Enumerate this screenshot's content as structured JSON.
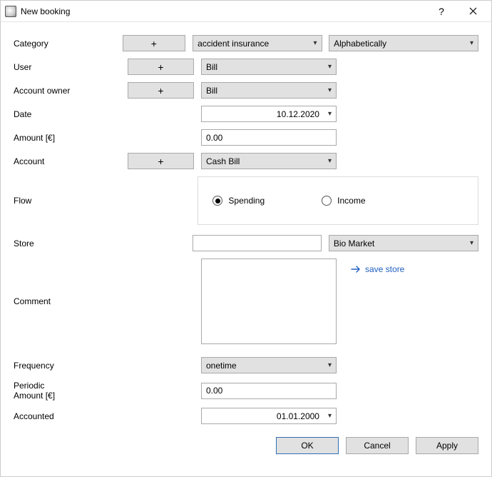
{
  "window": {
    "title": "New booking"
  },
  "labels": {
    "category": "Category",
    "user": "User",
    "account_owner": "Account owner",
    "date": "Date",
    "amount": "Amount [€]",
    "account": "Account",
    "flow": "Flow",
    "store": "Store",
    "comment": "Comment",
    "frequency": "Frequency",
    "periodic_amount": "Periodic\nAmount [€]",
    "accounted": "Accounted"
  },
  "values": {
    "category": "accident insurance",
    "category_sort": "Alphabetically",
    "user": "Bill",
    "account_owner": "Bill",
    "date": "10.12.2020",
    "amount": "0.00",
    "account": "Cash Bill",
    "flow_spending": "Spending",
    "flow_income": "Income",
    "flow_selected": "spending",
    "store": "",
    "store_preset": "Bio Market",
    "save_store": "save store",
    "comment": "",
    "frequency": "onetime",
    "periodic_amount": "0.00",
    "accounted": "01.01.2000"
  },
  "buttons": {
    "plus": "+",
    "ok": "OK",
    "cancel": "Cancel",
    "apply": "Apply"
  }
}
